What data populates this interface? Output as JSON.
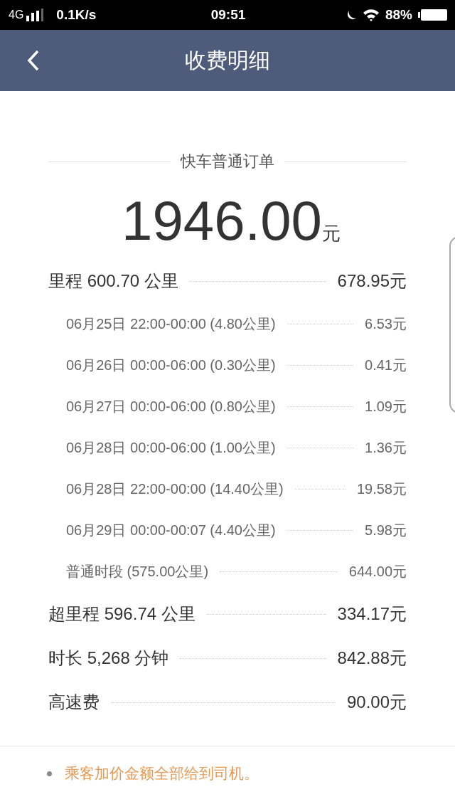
{
  "status_bar": {
    "network": "4G",
    "speed": "0.1K/s",
    "time": "09:51",
    "battery": "88%"
  },
  "nav": {
    "title": "收费明细"
  },
  "order": {
    "type": "快车普通订单",
    "amount": "1946.00",
    "unit": "元"
  },
  "items": [
    {
      "kind": "main",
      "label": "里程 600.70 公里",
      "price": "678.95元"
    },
    {
      "kind": "sub",
      "label": "06月25日 22:00-00:00 (4.80公里)",
      "price": "6.53元"
    },
    {
      "kind": "sub",
      "label": "06月26日 00:00-06:00 (0.30公里)",
      "price": "0.41元"
    },
    {
      "kind": "sub",
      "label": "06月27日 00:00-06:00 (0.80公里)",
      "price": "1.09元"
    },
    {
      "kind": "sub",
      "label": "06月28日 00:00-06:00 (1.00公里)",
      "price": "1.36元"
    },
    {
      "kind": "sub",
      "label": "06月28日 22:00-00:00 (14.40公里)",
      "price": "19.58元"
    },
    {
      "kind": "sub",
      "label": "06月29日 00:00-00:07 (4.40公里)",
      "price": "5.98元"
    },
    {
      "kind": "sub",
      "label": "普通时段 (575.00公里)",
      "price": "644.00元"
    },
    {
      "kind": "main",
      "label": "超里程 596.74 公里",
      "price": "334.17元"
    },
    {
      "kind": "main",
      "label": "时长 5,268 分钟",
      "price": "842.88元"
    },
    {
      "kind": "main",
      "label": "高速费",
      "price": "90.00元"
    }
  ],
  "notes": [
    "乘客加价金额全部给到司机。"
  ]
}
